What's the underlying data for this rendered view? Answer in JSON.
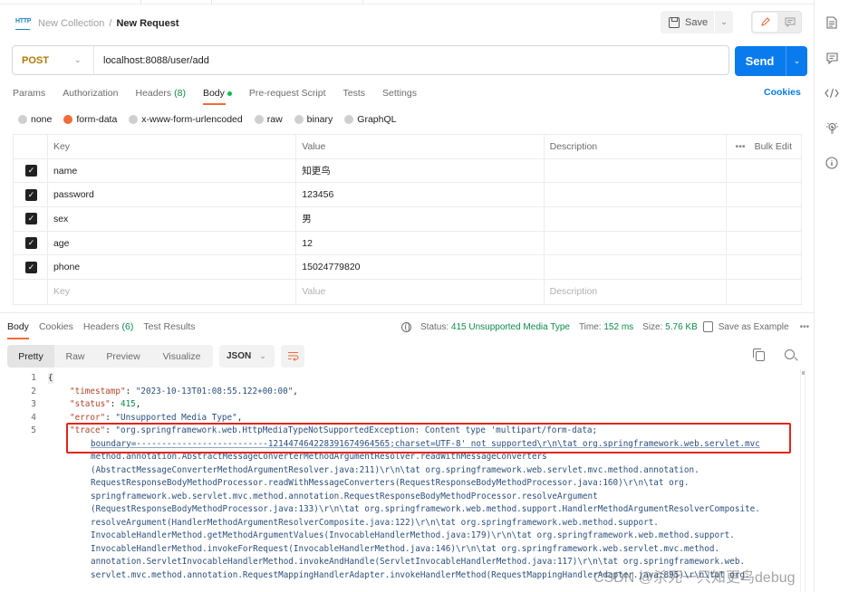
{
  "header": {
    "breadcrumb_collection": "New Collection",
    "breadcrumb_separator": "/",
    "breadcrumb_request": "New Request",
    "http_icon_label": "HTTP",
    "save_label": "Save"
  },
  "request": {
    "method": "POST",
    "url": "localhost:8088/user/add",
    "send_label": "Send",
    "tabs": [
      {
        "label": "Params"
      },
      {
        "label": "Authorization"
      },
      {
        "label": "Headers",
        "count": "(8)"
      },
      {
        "label": "Body",
        "active": true,
        "indicator": "green-dot"
      },
      {
        "label": "Pre-request Script"
      },
      {
        "label": "Tests"
      },
      {
        "label": "Settings"
      }
    ],
    "cookies_label": "Cookies",
    "body_types": [
      {
        "label": "none"
      },
      {
        "label": "form-data",
        "selected": true
      },
      {
        "label": "x-www-form-urlencoded"
      },
      {
        "label": "raw"
      },
      {
        "label": "binary"
      },
      {
        "label": "GraphQL"
      }
    ],
    "table": {
      "headers": {
        "key": "Key",
        "value": "Value",
        "description": "Description",
        "bulk_edit": "Bulk Edit",
        "more": "•••"
      },
      "rows": [
        {
          "checked": true,
          "key": "name",
          "value": "知更鸟",
          "description": ""
        },
        {
          "checked": true,
          "key": "password",
          "value": "123456",
          "description": ""
        },
        {
          "checked": true,
          "key": "sex",
          "value": "男",
          "description": ""
        },
        {
          "checked": true,
          "key": "age",
          "value": "12",
          "description": ""
        },
        {
          "checked": true,
          "key": "phone",
          "value": "15024779820",
          "description": ""
        }
      ],
      "placeholder": {
        "key": "Key",
        "value": "Value",
        "description": "Description"
      }
    }
  },
  "response": {
    "tabs": [
      {
        "label": "Body",
        "active": true
      },
      {
        "label": "Cookies"
      },
      {
        "label": "Headers",
        "count": "(6)"
      },
      {
        "label": "Test Results"
      }
    ],
    "status_label": "Status:",
    "status_value": "415 Unsupported Media Type",
    "time_label": "Time:",
    "time_value": "152 ms",
    "size_label": "Size:",
    "size_value": "5.76 KB",
    "save_example_label": "Save as Example",
    "more": "•••",
    "view_modes": [
      "Pretty",
      "Raw",
      "Preview",
      "Visualize"
    ],
    "active_view": "Pretty",
    "format": "JSON",
    "line_numbers": [
      "1",
      "2",
      "3",
      "4",
      "5"
    ],
    "code": {
      "open_brace": "{",
      "timestamp_key": "\"timestamp\"",
      "timestamp_val": "\"2023-10-13T01:08:55.122+00:00\"",
      "status_key": "\"status\"",
      "status_val": "415",
      "error_key": "\"error\"",
      "error_val": "\"Unsupported Media Type\"",
      "trace_key": "\"trace\"",
      "trace_lines": [
        "\"org.springframework.web.HttpMediaTypeNotSupportedException: Content type 'multipart/form-data;",
        "boundary=--------------------------121447464228391674964565;charset=UTF-8' not supported\\r\\n\\tat org.springframework.web.servlet.mvc",
        "method.annotation.AbstractMessageConverterMethodArgumentResolver.readWithMessageConverters",
        "(AbstractMessageConverterMethodArgumentResolver.java:211)\\r\\n\\tat org.springframework.web.servlet.mvc.method.annotation.",
        "RequestResponseBodyMethodProcessor.readWithMessageConverters(RequestResponseBodyMethodProcessor.java:160)\\r\\n\\tat org.",
        "springframework.web.servlet.mvc.method.annotation.RequestResponseBodyMethodProcessor.resolveArgument",
        "(RequestResponseBodyMethodProcessor.java:133)\\r\\n\\tat org.springframework.web.method.support.HandlerMethodArgumentResolverComposite.",
        "resolveArgument(HandlerMethodArgumentResolverComposite.java:122)\\r\\n\\tat org.springframework.web.method.support.",
        "InvocableHandlerMethod.getMethodArgumentValues(InvocableHandlerMethod.java:179)\\r\\n\\tat org.springframework.web.method.support.",
        "InvocableHandlerMethod.invokeForRequest(InvocableHandlerMethod.java:146)\\r\\n\\tat org.springframework.web.servlet.mvc.method.",
        "annotation.ServletInvocableHandlerMethod.invokeAndHandle(ServletInvocableHandlerMethod.java:117)\\r\\n\\tat org.springframework.web.",
        "servlet.mvc.method.annotation.RequestMappingHandlerAdapter.invokeHandlerMethod(RequestMappingHandlerAdapter.java:895)\\r\\n\\tat org."
      ]
    }
  },
  "watermark": "CSDN @杀死一只知更鸟debug",
  "colors": {
    "accent": "#f26b3a",
    "send": "#097bed",
    "method": "#ad7a03",
    "success_text": "#0f8a4a",
    "highlight_box": "#e1251b"
  }
}
